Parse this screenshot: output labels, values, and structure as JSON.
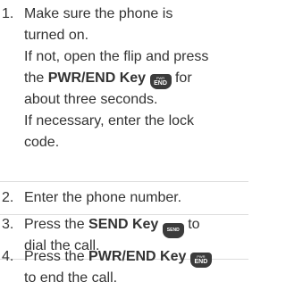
{
  "steps": [
    {
      "number": "1.",
      "lines": [
        "Make sure the phone is",
        "turned on.",
        "If not, open the flip and press",
        "the",
        "PWR/END Key",
        "for",
        "about three seconds.",
        "If necessary, enter the lock",
        "code."
      ]
    },
    {
      "number": "2.",
      "lines": [
        "Enter the phone number."
      ]
    },
    {
      "number": "3.",
      "lines": [
        "Press the",
        "SEND Key",
        "to",
        "dial the call."
      ]
    },
    {
      "number": "4.",
      "lines": [
        "Press the",
        "PWR/END Key",
        "to end the call."
      ]
    }
  ],
  "keys": {
    "pwr_end": {
      "icon": "pwr-end-key-icon",
      "top": "PWR",
      "bottom": "END"
    },
    "send": {
      "icon": "send-key-icon",
      "label": "SEND"
    }
  },
  "colors": {
    "text": "#333333",
    "key_bg": "#3b3b3b",
    "divider": "#dddddd"
  }
}
